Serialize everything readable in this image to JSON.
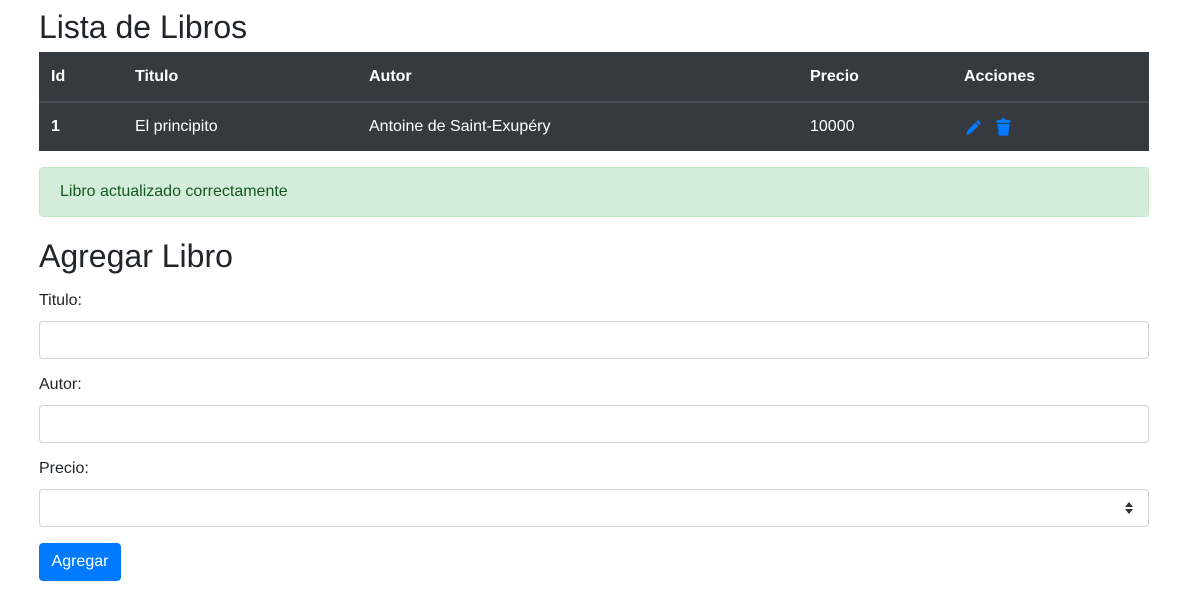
{
  "list": {
    "title": "Lista de Libros",
    "columns": {
      "id": "Id",
      "titulo": "Titulo",
      "autor": "Autor",
      "precio": "Precio",
      "acciones": "Acciones"
    },
    "rows": [
      {
        "id": "1",
        "titulo": "El principito",
        "autor": "Antoine de Saint-Exupéry",
        "precio": "10000"
      }
    ],
    "icons": {
      "edit": "pencil-icon",
      "delete": "trash-icon"
    }
  },
  "alert": {
    "message": "Libro actualizado correctamente"
  },
  "form": {
    "title": "Agregar Libro",
    "titulo_label": "Titulo:",
    "titulo_value": "",
    "autor_label": "Autor:",
    "autor_value": "",
    "precio_label": "Precio:",
    "precio_value": "",
    "submit_label": "Agregar"
  },
  "colors": {
    "table_bg": "#343a40",
    "accent": "#007bff",
    "success_bg": "#d4edda",
    "success_text": "#155724"
  }
}
